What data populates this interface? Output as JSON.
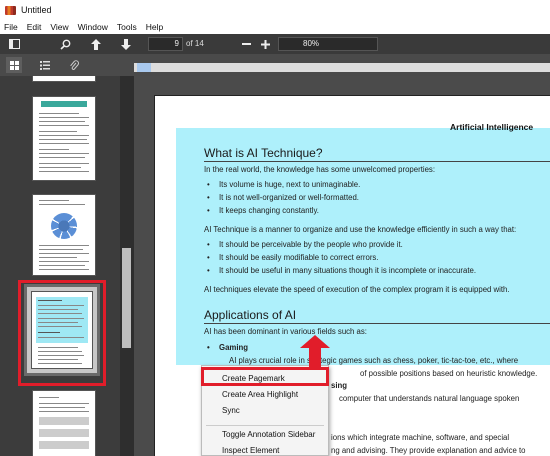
{
  "window": {
    "title": "Untitled"
  },
  "menu": [
    "File",
    "Edit",
    "View",
    "Window",
    "Tools",
    "Help"
  ],
  "toolbar": {
    "current_page": "9",
    "page_total_label": "of 14",
    "zoom": "80%"
  },
  "document": {
    "header": "Artificial Intelligence",
    "section1_title": "What is AI Technique?",
    "intro": "In the real world, the knowledge has some unwelcomed properties:",
    "props": [
      "Its volume is huge, next to unimaginable.",
      "It is not well-organized or well-formatted.",
      "It keeps changing constantly."
    ],
    "technique": "AI Technique is a manner to organize and use the knowledge efficiently in such a way that:",
    "should": [
      "It should be perceivable by the people who provide it.",
      "It should be easily modifiable to correct errors.",
      "It should be useful in many situations though it is incomplete or inaccurate."
    ],
    "elevate": "AI techniques elevate the speed of execution of the complex program it is equipped with.",
    "section2_title": "Applications of AI",
    "dominant": "AI has been dominant in various fields such as:",
    "gaming": "Gaming",
    "gaming_text_a": "AI plays crucial role in strategic games such as chess, poker, tic-tac-toe, etc., where",
    "gaming_text_b": "of possible positions based on heuristic knowledge.",
    "processing_frag": "sing",
    "computer_frag": "computer that understands natural language spoken",
    "ions_frag": "ions which integrate machine, software, and special",
    "advising_frag": "ng and advising. They provide explanation and advice to"
  },
  "context_menu": {
    "items": [
      "Create Pagemark",
      "Create Area Highlight",
      "Sync",
      "Toggle Annotation Sidebar",
      "Inspect Element"
    ]
  },
  "colors": {
    "highlight": "#aef0fb",
    "annotation_red": "#e11d2a"
  }
}
